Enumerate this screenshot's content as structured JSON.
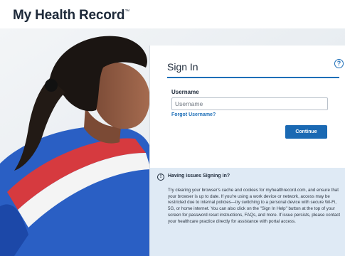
{
  "header": {
    "logo_text": "My Health Record",
    "logo_mark": "™"
  },
  "signin": {
    "title": "Sign In",
    "help_icon": "question-circle-icon",
    "username_label": "Username",
    "username_placeholder": "Username",
    "username_value": "",
    "forgot_link": "Forgot Username?",
    "continue_label": "Continue"
  },
  "issues": {
    "icon": "info-circle-icon",
    "title": "Having issues Signing in?",
    "body": "Try clearing your browser's cache and cookies for myhealthrecord.com, and ensure that your browser is up to date. If you're using a work device or network, access may be restricted due to internal policies—try switching to a personal device with secure Wi-Fi, 5G, or home internet. You can also click on the \"Sign In Help\" button at the top of your screen for password reset instructions, FAQs, and more. If issue persists, please contact your healthcare practice directly for assistance with portal access."
  },
  "colors": {
    "accent": "#1e6fb8",
    "button": "#1a69b3",
    "info_bg": "#dfeaf5",
    "text_dark": "#1e2a3a"
  }
}
